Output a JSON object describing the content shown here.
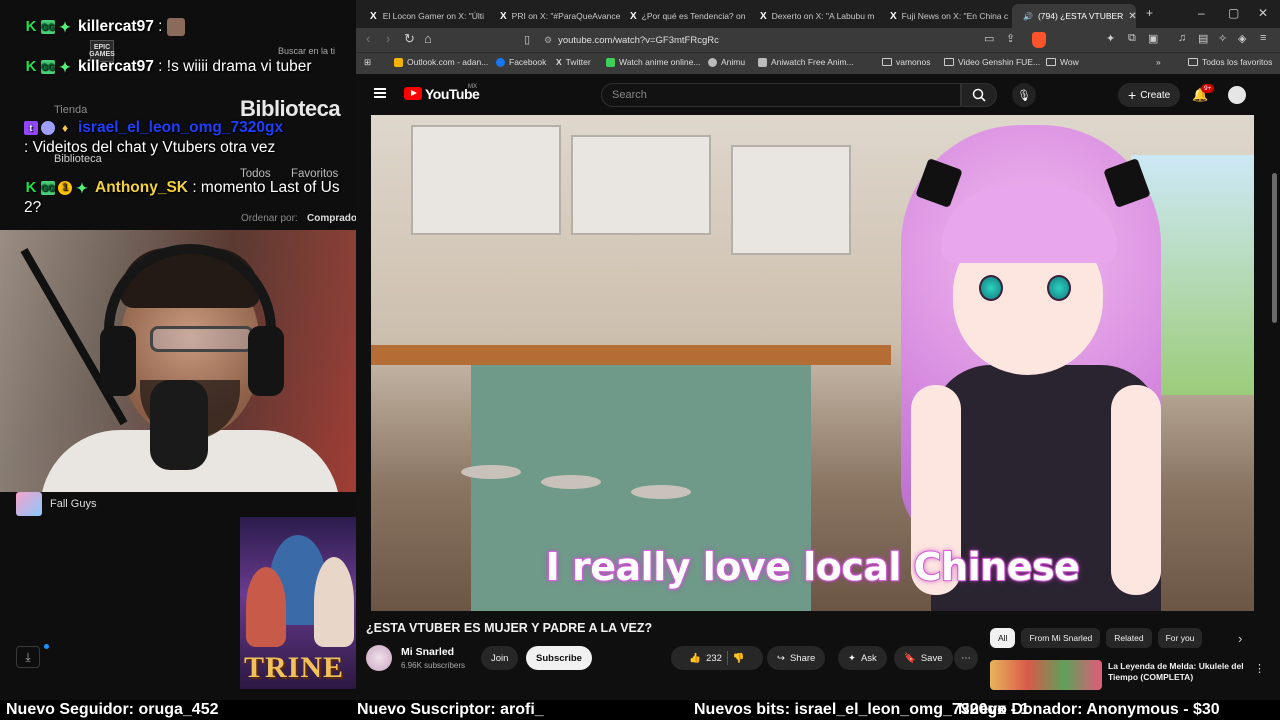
{
  "overlay": {
    "chat": [
      {
        "user": "killercat97",
        "message": ":",
        "user_color": "#ffffff"
      },
      {
        "user": "killercat97",
        "message": ": !s wiiii drama vi tuber",
        "user_color": "#ffffff"
      },
      {
        "user": "israel_el_leon_omg_7320gx",
        "message": ": Videitos del chat y Vtubers otra vez",
        "user_color": "#1e3fff"
      },
      {
        "user": "Anthony_SK",
        "message": ": momento Last of Us 2?",
        "user_color": "#f5d23b"
      }
    ],
    "launcher": {
      "search_placeholder": "Buscar en la ti",
      "library_title": "Biblioteca",
      "store_label": "Tienda",
      "library_nav": "Biblioteca",
      "tab_all": "Todos",
      "tab_favorites": "Favoritos",
      "sort_label": "Ordenar por:",
      "sort_value": "Comprado",
      "epic_logo_text": "EPIC GAMES"
    },
    "now_playing": "Fall Guys",
    "trine_logo": "TRINE"
  },
  "browser": {
    "tabs": [
      {
        "label": "El Locon Gamer on X: \"Últi",
        "icon": "x-icon"
      },
      {
        "label": "PRI on X: \"#ParaQueAvance",
        "icon": "x-icon"
      },
      {
        "label": "¿Por qué es Tendencia? on",
        "icon": "x-icon"
      },
      {
        "label": "Dexerto on X: \"A Labubu m",
        "icon": "x-icon"
      },
      {
        "label": "Fuji News on X: \"En China c",
        "icon": "x-icon"
      },
      {
        "label": "(794) ¿ESTA VTUBER",
        "icon": "youtube-icon",
        "active": true
      }
    ],
    "url": "youtube.com/watch?v=GF3mtFRcgRc",
    "bookmarks": [
      {
        "label": "Outlook.com - adan...",
        "color": "#f4b400"
      },
      {
        "label": "Facebook",
        "color": "#1877f2"
      },
      {
        "label": "Twitter",
        "color": "#ffffff"
      },
      {
        "label": "Watch anime online...",
        "color": "#3ecf5a"
      },
      {
        "label": "Animu",
        "color": "#bbbbbb"
      },
      {
        "label": "Aniwatch Free Anim...",
        "color": "#bbbbbb"
      },
      {
        "label": "vamonos",
        "color": "folder"
      },
      {
        "label": "Video Genshin FUE...",
        "color": "folder"
      },
      {
        "label": "Wow",
        "color": "folder"
      }
    ],
    "all_bookmarks": "Todos los favoritos"
  },
  "youtube": {
    "logo": "YouTube",
    "region": "MX",
    "search_placeholder": "Search",
    "create_label": "Create",
    "notif_count": "9+",
    "caption": "I really love local Chinese",
    "video_title": "¿ESTA VTUBER ES MUJER Y PADRE A LA VEZ?",
    "channel_name": "Mi Snarled",
    "subscribers": "6.96K subscribers",
    "join_label": "Join",
    "subscribe_label": "Subscribe",
    "likes": "232",
    "share_label": "Share",
    "ask_label": "Ask",
    "save_label": "Save",
    "chips": [
      "All",
      "From Mi Snarled",
      "Related",
      "For you"
    ],
    "rec_title": "La Leyenda de Melda: Ukulele del Tiempo (COMPLETA)"
  },
  "ticker": {
    "follower": "Nuevo Seguidor: oruga_452",
    "subscriber": "Nuevo Suscriptor: arofi_",
    "bits": "Nuevos bits: israel_el_leon_omg_7320gx - 1",
    "donation": "Nuevo Donador: Anonymous - $30"
  }
}
